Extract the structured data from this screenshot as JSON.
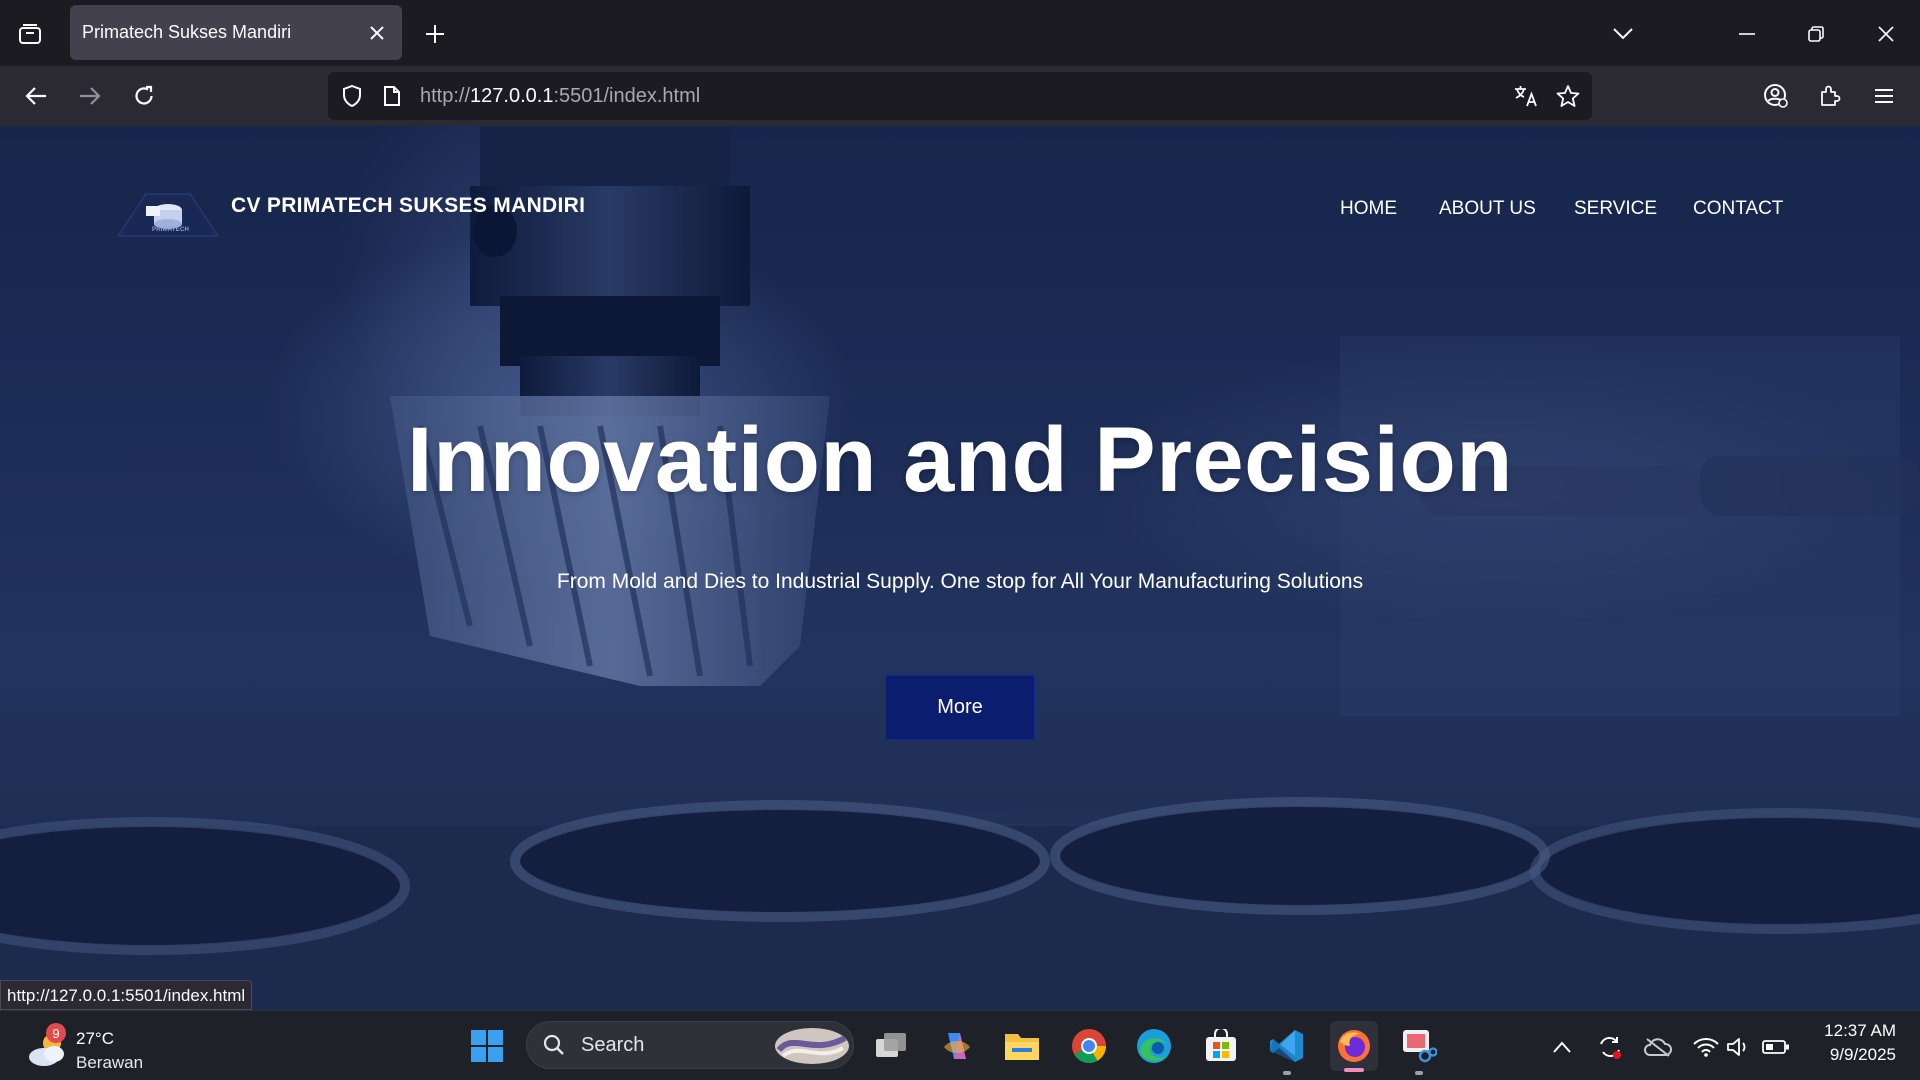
{
  "browser": {
    "tab_title": "Primatech Sukses Mandiri",
    "url_prefix": "http://",
    "url_host": "127.0.0.1",
    "url_rest": ":5501/index.html",
    "status_url": "http://127.0.0.1:5501/index.html"
  },
  "site": {
    "brand_name": "CV PRIMATECH SUKSES MANDIRI",
    "logo_text": "PRIMATECH",
    "nav": [
      "HOME",
      "ABOUT US",
      "SERVICE",
      "CONTACT"
    ],
    "hero_title": "Innovation and Precision",
    "hero_subtitle": "From Mold and Dies to Industrial Supply. One stop for All Your Manufacturing Solutions",
    "cta_label": "More",
    "colors": {
      "cta_bg": "#0b1d6e",
      "overlay": "#1b2a4d"
    }
  },
  "taskbar": {
    "weather_temp": "27°C",
    "weather_desc": "Berawan",
    "weather_badge": "9",
    "search_label": "Search",
    "time": "12:37 AM",
    "date": "9/9/2025"
  }
}
